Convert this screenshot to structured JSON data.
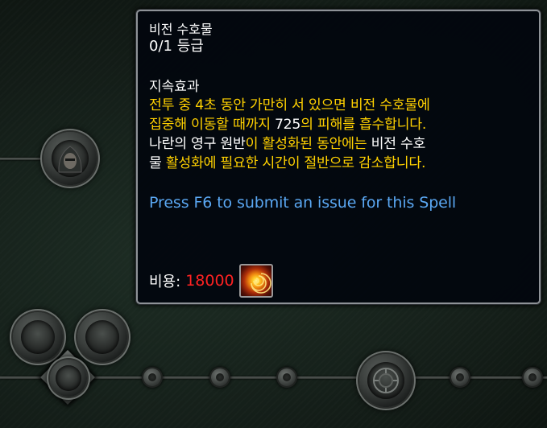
{
  "tooltip": {
    "spell_name": "비전 수호물",
    "rank": "0/1 등급",
    "effect_heading": "지속효과",
    "description_lines": [
      [
        {
          "text": "전투 중 4초 동안 가만히 서 있으면 비전 수호물에",
          "color": "gold"
        }
      ],
      [
        {
          "text": "집중해 이동할 때까지 ",
          "color": "gold"
        },
        {
          "text": "725",
          "color": "white"
        },
        {
          "text": "의 피해를 흡수합니다.",
          "color": "gold"
        }
      ],
      [
        {
          "text": "나란의 영구 원반",
          "color": "white"
        },
        {
          "text": "이 활성화된 동안에는 ",
          "color": "gold"
        },
        {
          "text": "비전 수호",
          "color": "white"
        }
      ],
      [
        {
          "text": "물",
          "color": "white"
        },
        {
          "text": " 활성화에 필요한 시간이 절반으로 감소합니다.",
          "color": "gold"
        }
      ]
    ],
    "issue_link": "Press F6 to submit an issue for this Spell",
    "cost_label": "비용:",
    "cost_value": "18000",
    "cost_icon": "arcane-swirl-icon"
  },
  "colors": {
    "gold": "#ffd100",
    "white": "#ffffff",
    "link_blue": "#5aa7f2",
    "cost_red": "#ff2222",
    "tooltip_border": "#8e9297"
  }
}
